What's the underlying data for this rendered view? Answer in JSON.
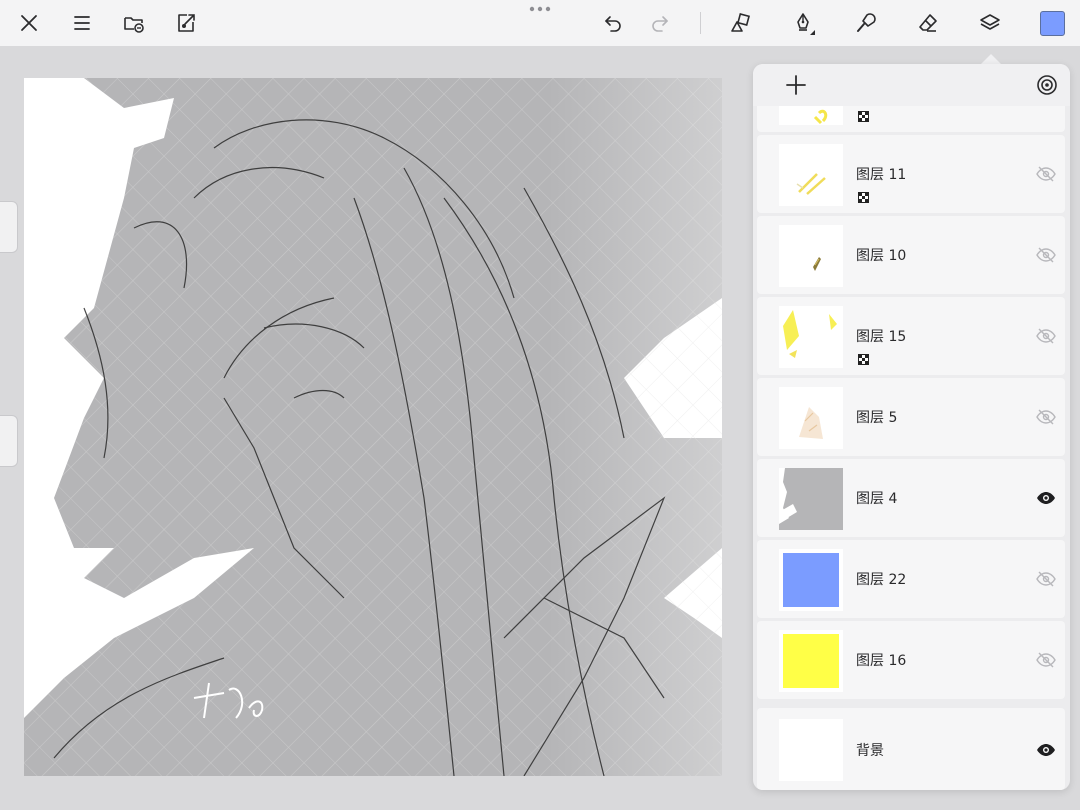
{
  "toolbar": {
    "colors": {
      "current_color": "#7b9cff",
      "icon": "#2b2b2d",
      "icon_disabled": "#b4b4b8"
    }
  },
  "panel": {
    "layers": [
      {
        "name": "",
        "visible": null,
        "alpha_lock": true,
        "thumb": "partial-yellow"
      },
      {
        "name": "图层 11",
        "visible": false,
        "alpha_lock": true,
        "thumb": "yellow-stroke"
      },
      {
        "name": "图层 10",
        "visible": false,
        "alpha_lock": false,
        "thumb": "small-stroke"
      },
      {
        "name": "图层 15",
        "visible": false,
        "alpha_lock": true,
        "thumb": "yellow-highlights"
      },
      {
        "name": "图层 5",
        "visible": false,
        "alpha_lock": false,
        "thumb": "faint-sketch"
      },
      {
        "name": "图层 4",
        "visible": true,
        "alpha_lock": false,
        "thumb": "gray-silhouette"
      },
      {
        "name": "图层 22",
        "visible": false,
        "alpha_lock": false,
        "thumb": "fill",
        "fill": "#7b9cff"
      },
      {
        "name": "图层 16",
        "visible": false,
        "alpha_lock": false,
        "thumb": "fill",
        "fill": "#ffff47"
      },
      {
        "name": "背景",
        "visible": true,
        "alpha_lock": false,
        "thumb": "white"
      }
    ]
  }
}
